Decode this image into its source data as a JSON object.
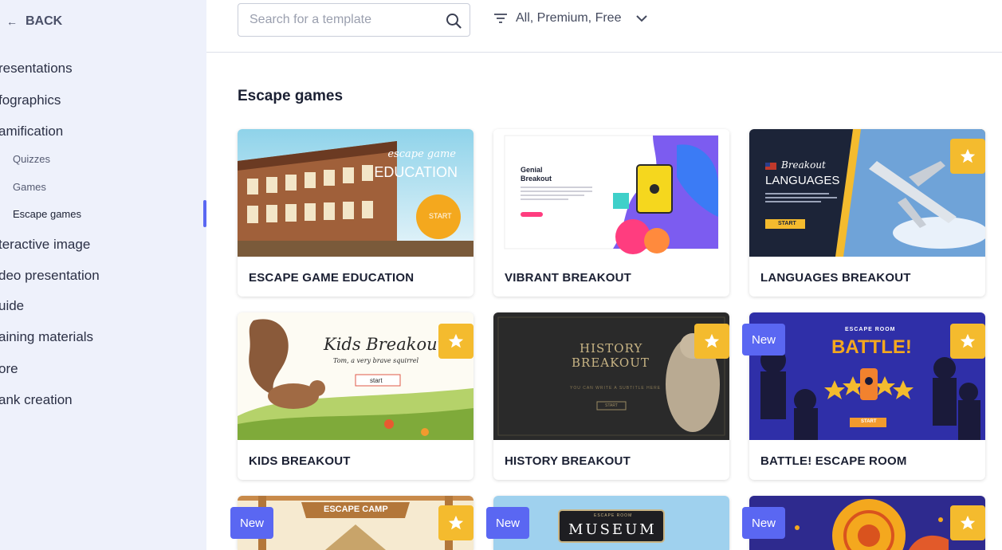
{
  "sidebar": {
    "back_label": "BACK",
    "items": [
      {
        "label": "resentations"
      },
      {
        "label": "fographics"
      },
      {
        "label": "amification"
      },
      {
        "label": "teractive image"
      },
      {
        "label": "deo presentation"
      },
      {
        "label": "uide"
      },
      {
        "label": "aining materials"
      },
      {
        "label": "ore"
      },
      {
        "label": "ank creation"
      }
    ],
    "sub_items": [
      {
        "label": "Quizzes"
      },
      {
        "label": "Games"
      },
      {
        "label": "Escape games"
      }
    ]
  },
  "search": {
    "placeholder": "Search for a template",
    "value": ""
  },
  "filter": {
    "label": "All, Premium, Free"
  },
  "section": {
    "title": "Escape games"
  },
  "cards": [
    {
      "title": "ESCAPE GAME EDUCATION",
      "thumb_title_line1": "escape game",
      "thumb_title_line2": "EDUCATION",
      "thumb_button": "START"
    },
    {
      "title": "VIBRANT BREAKOUT",
      "thumb_title_line1": "Genial",
      "thumb_title_line2": "Breakout"
    },
    {
      "title": "LANGUAGES BREAKOUT",
      "thumb_title_line1": "Breakout",
      "thumb_title_line2": "LANGUAGES",
      "thumb_button": "START"
    },
    {
      "title": "KIDS BREAKOUT",
      "thumb_title_line1": "Kids Breakout",
      "thumb_title_line2": "Tom, a very brave squirrel",
      "thumb_button": "start"
    },
    {
      "title": "HISTORY BREAKOUT",
      "thumb_title_line1": "HISTORY",
      "thumb_title_line2": "BREAKOUT",
      "thumb_subtitle": "YOU CAN WRITE A SUBTITLE HERE",
      "thumb_button": "START"
    },
    {
      "title": "BATTLE! ESCAPE ROOM",
      "thumb_title_line1": "ESCAPE ROOM",
      "thumb_title_line2": "BATTLE!",
      "thumb_button": "START"
    },
    {
      "title": "",
      "thumb_title_line1": "ESCAPE CAMP"
    },
    {
      "title": "",
      "thumb_title_line1": "ESCAPE ROOM",
      "thumb_title_line2": "MUSEUM"
    },
    {
      "title": ""
    }
  ],
  "badges": {
    "new_label": "New"
  },
  "colors": {
    "accent": "#5a67f2",
    "premium": "#f4bb2e",
    "sidebar_bg": "#eef1fb"
  }
}
